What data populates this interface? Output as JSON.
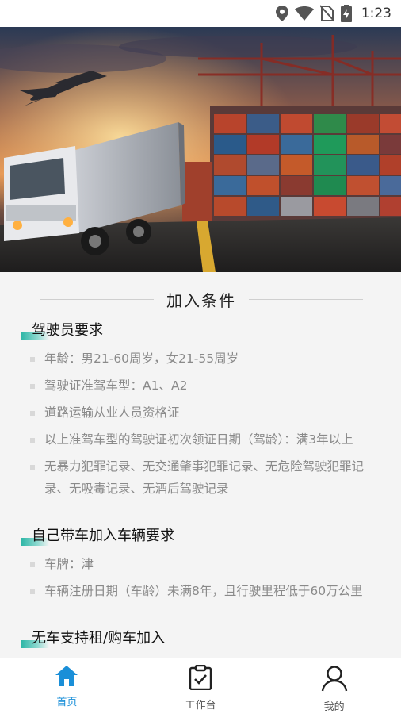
{
  "status_bar": {
    "time": "1:23",
    "icons": [
      "location-icon",
      "wifi-icon",
      "no-sim-icon",
      "battery-charging-icon"
    ]
  },
  "hero": {
    "image": "logistics-banner: truck, airplane, container port at sunset"
  },
  "section": {
    "title": "加入条件"
  },
  "groups": [
    {
      "title": "驾驶员要求",
      "items": [
        "年龄：男21-60周岁，女21-55周岁",
        "驾驶证准驾车型：A1、A2",
        "道路运输从业人员资格证",
        "以上准驾车型的驾驶证初次领证日期（驾龄）：满3年以上",
        "无暴力犯罪记录、无交通肇事犯罪记录、无危险驾驶犯罪记录、无吸毒记录、无酒后驾驶记录"
      ]
    },
    {
      "title": "自己带车加入车辆要求",
      "items": [
        "车牌：津",
        "车辆注册日期（车龄）未满8年，且行驶里程低于60万公里"
      ]
    },
    {
      "title": "无车支持租/购车加入",
      "items": []
    }
  ],
  "bottom_nav": {
    "active_color": "#1a8fd8",
    "items": [
      {
        "label": "首页",
        "icon": "home-icon",
        "active": true
      },
      {
        "label": "工作台",
        "icon": "clipboard-check-icon",
        "active": false
      },
      {
        "label": "我的",
        "icon": "user-icon",
        "active": false
      }
    ]
  }
}
